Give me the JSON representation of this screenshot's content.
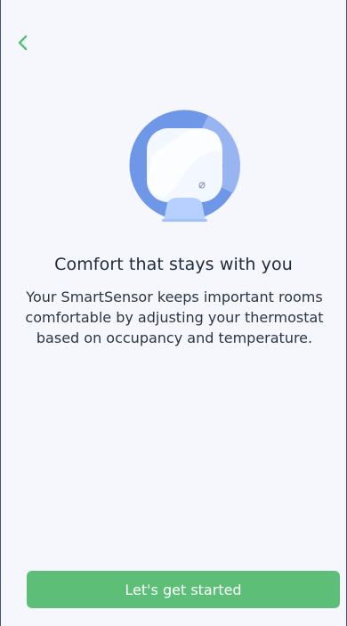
{
  "header": {
    "back_icon": "chevron-left-icon"
  },
  "hero": {
    "illustration": "smartsensor-illustration",
    "title": "Comfort that stays with you",
    "description": "Your SmartSensor keeps important rooms comfortable by adjusting your thermostat based on occupancy and temperature."
  },
  "footer": {
    "cta_label": "Let's get started"
  },
  "colors": {
    "accent": "#5dbf77",
    "sensor_ring": "#6f97e7",
    "sensor_ring_light": "#9cb8f2",
    "sensor_face": "#f3f7ff",
    "sensor_stand": "#b6d0ff"
  }
}
